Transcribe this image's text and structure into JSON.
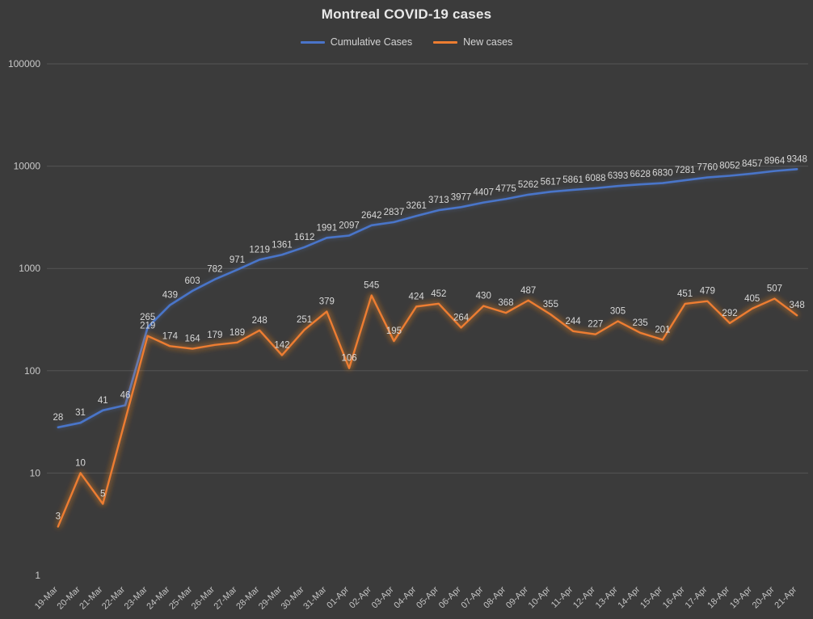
{
  "chart_data": {
    "type": "line",
    "title": "Montreal COVID-19 cases",
    "xlabel": "",
    "ylabel": "",
    "yscale": "log",
    "ylim": [
      1,
      100000
    ],
    "ytick_labels": [
      "1",
      "10",
      "100",
      "1000",
      "10000",
      "100000"
    ],
    "ytick_values": [
      1,
      10,
      100,
      1000,
      10000,
      100000
    ],
    "grid": true,
    "legend_position": "top-center",
    "background_color": "#3b3b3b",
    "categories": [
      "19-Mar",
      "20-Mar",
      "21-Mar",
      "22-Mar",
      "23-Mar",
      "24-Mar",
      "25-Mar",
      "26-Mar",
      "27-Mar",
      "28-Mar",
      "29-Mar",
      "30-Mar",
      "31-Mar",
      "01-Apr",
      "02-Apr",
      "03-Apr",
      "04-Apr",
      "05-Apr",
      "06-Apr",
      "07-Apr",
      "08-Apr",
      "09-Apr",
      "10-Apr",
      "11-Apr",
      "12-Apr",
      "13-Apr",
      "14-Apr",
      "15-Apr",
      "16-Apr",
      "17-Apr",
      "18-Apr",
      "19-Apr",
      "20-Apr",
      "21-Apr"
    ],
    "series": [
      {
        "name": "Cumulative Cases",
        "color": "#4a74c9",
        "show_labels_from_index": 0,
        "values": [
          28,
          31,
          41,
          46,
          265,
          439,
          603,
          782,
          971,
          1219,
          1361,
          1612,
          1991,
          2097,
          2642,
          2837,
          3261,
          3713,
          3977,
          4407,
          4775,
          5262,
          5617,
          5861,
          6088,
          6393,
          6628,
          6830,
          7281,
          7760,
          8052,
          8457,
          8964,
          9348
        ]
      },
      {
        "name": "New cases",
        "color": "#ed7d31",
        "glow": true,
        "values": [
          3,
          10,
          5,
          null,
          219,
          174,
          164,
          179,
          189,
          248,
          142,
          251,
          379,
          106,
          545,
          195,
          424,
          452,
          264,
          430,
          368,
          487,
          355,
          244,
          227,
          305,
          235,
          201,
          451,
          479,
          292,
          405,
          507,
          348
        ]
      }
    ]
  },
  "legend": {
    "items": [
      {
        "label": "Cumulative Cases",
        "color": "#4a74c9"
      },
      {
        "label": "New cases",
        "color": "#ed7d31"
      }
    ]
  }
}
